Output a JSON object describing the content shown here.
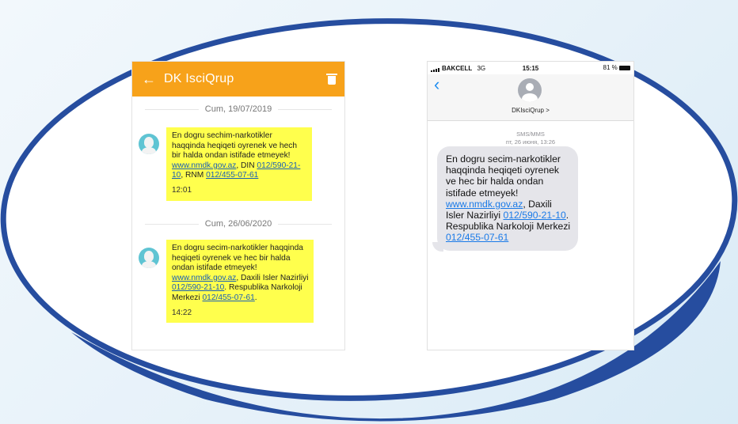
{
  "colors": {
    "android_appbar": "#f7a21a",
    "sms_bubble_yellow": "#ffff4d",
    "ios_bubble_gray": "#e5e5ea",
    "link_blue": "#1a5fb4",
    "ellipse_border": "#264d9f"
  },
  "android": {
    "back_icon": "arrow-left-icon",
    "title": "DK IsciQrup",
    "delete_icon": "trash-icon",
    "messages": [
      {
        "date": "Cum, 19/07/2019",
        "text_1": "En dogru sechim-narkotikler haqqinda heqiqeti oyrenek ve hech bir halda ondan istifade etmeyek!",
        "link_url": "www.nmdk.gov.az",
        "text_2": ", DIN",
        "link_phone_1": "012/590-21-10",
        "text_3": ", RNM",
        "link_phone_2": "012/455-07-61",
        "text_4": "",
        "time": "12:01"
      },
      {
        "date": "Cum, 26/06/2020",
        "text_1": "En dogru secim-narkotikler haqqinda heqiqeti oyrenek ve hec bir halda ondan istifade etmeyek!",
        "link_url": "www.nmdk.gov.az",
        "text_2": ", Daxili Isler Nazirliyi",
        "link_phone_1": "012/590-21-10",
        "text_3": ". Respublika Narkoloji Merkezi",
        "link_phone_2": "012/455-07-61",
        "text_4": ".",
        "time": "14:22"
      }
    ]
  },
  "ios": {
    "carrier": "BAKCELL",
    "network": "3G",
    "clock": "15:15",
    "battery": "81 %",
    "back_icon": "chevron-left-icon",
    "contact_name": "DKIsciQrup >",
    "message_type": "SMS/MMS",
    "timestamp": "пт, 26 июня, 13:26",
    "message": {
      "text_1": "En dogru secim-narkotikler haqqinda heqiqeti oyrenek ve hec bir halda ondan istifade etmeyek!",
      "link_url": "www.nmdk.gov.az",
      "text_2": ", Daxili Isler Nazirliyi",
      "link_phone_1": "012/590-21-10",
      "text_3": ". Respublika Narkoloji Merkezi",
      "link_phone_2": "012/455-07-61"
    }
  }
}
